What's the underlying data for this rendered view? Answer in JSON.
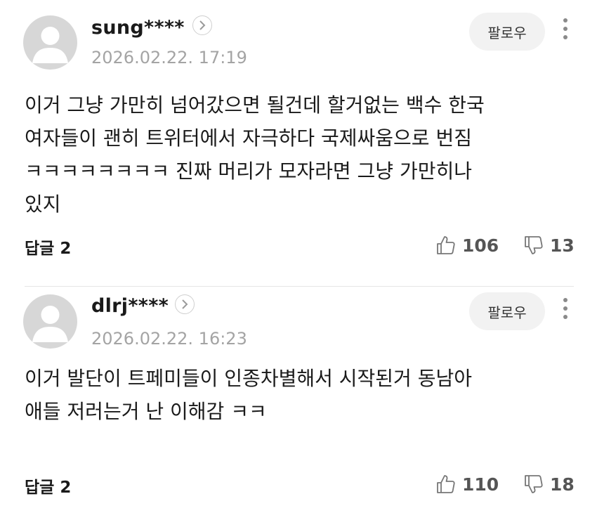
{
  "comments": [
    {
      "username": "sung****",
      "date": "2026.02.22. 17:19",
      "follow_label": "팔로우",
      "text": "이거 그냥 가만히 넘어갔으면 될건데 할거없는 백수 한국\n여자들이 괜히 트위터에서 자극하다 국제싸움으로 번짐\nㅋㅋㅋㅋㅋㅋㅋㅋ 진짜 머리가 모자라면 그냥 가만히나\n있지",
      "reply_label": "답글 2",
      "likes": "106",
      "dislikes": "13"
    },
    {
      "username": "dlrj****",
      "date": "2026.02.22. 16:23",
      "follow_label": "팔로우",
      "text": "이거 발단이 트페미들이 인종차별해서 시작된거 동남아\n애들 저러는거 난 이해감 ㅋㅋ",
      "reply_label": "답글 2",
      "likes": "110",
      "dislikes": "18"
    }
  ],
  "icons": {
    "avatar": "default-avatar-icon",
    "profile_link": "chevron-right-icon",
    "more": "more-vertical-icon",
    "like": "thumbs-up-icon",
    "dislike": "thumbs-down-icon"
  },
  "colors": {
    "avatar_bg": "#d7d7d7",
    "date": "#a4a4a4",
    "follow_bg": "#f2f2f2",
    "divider": "#e6e6e6"
  }
}
